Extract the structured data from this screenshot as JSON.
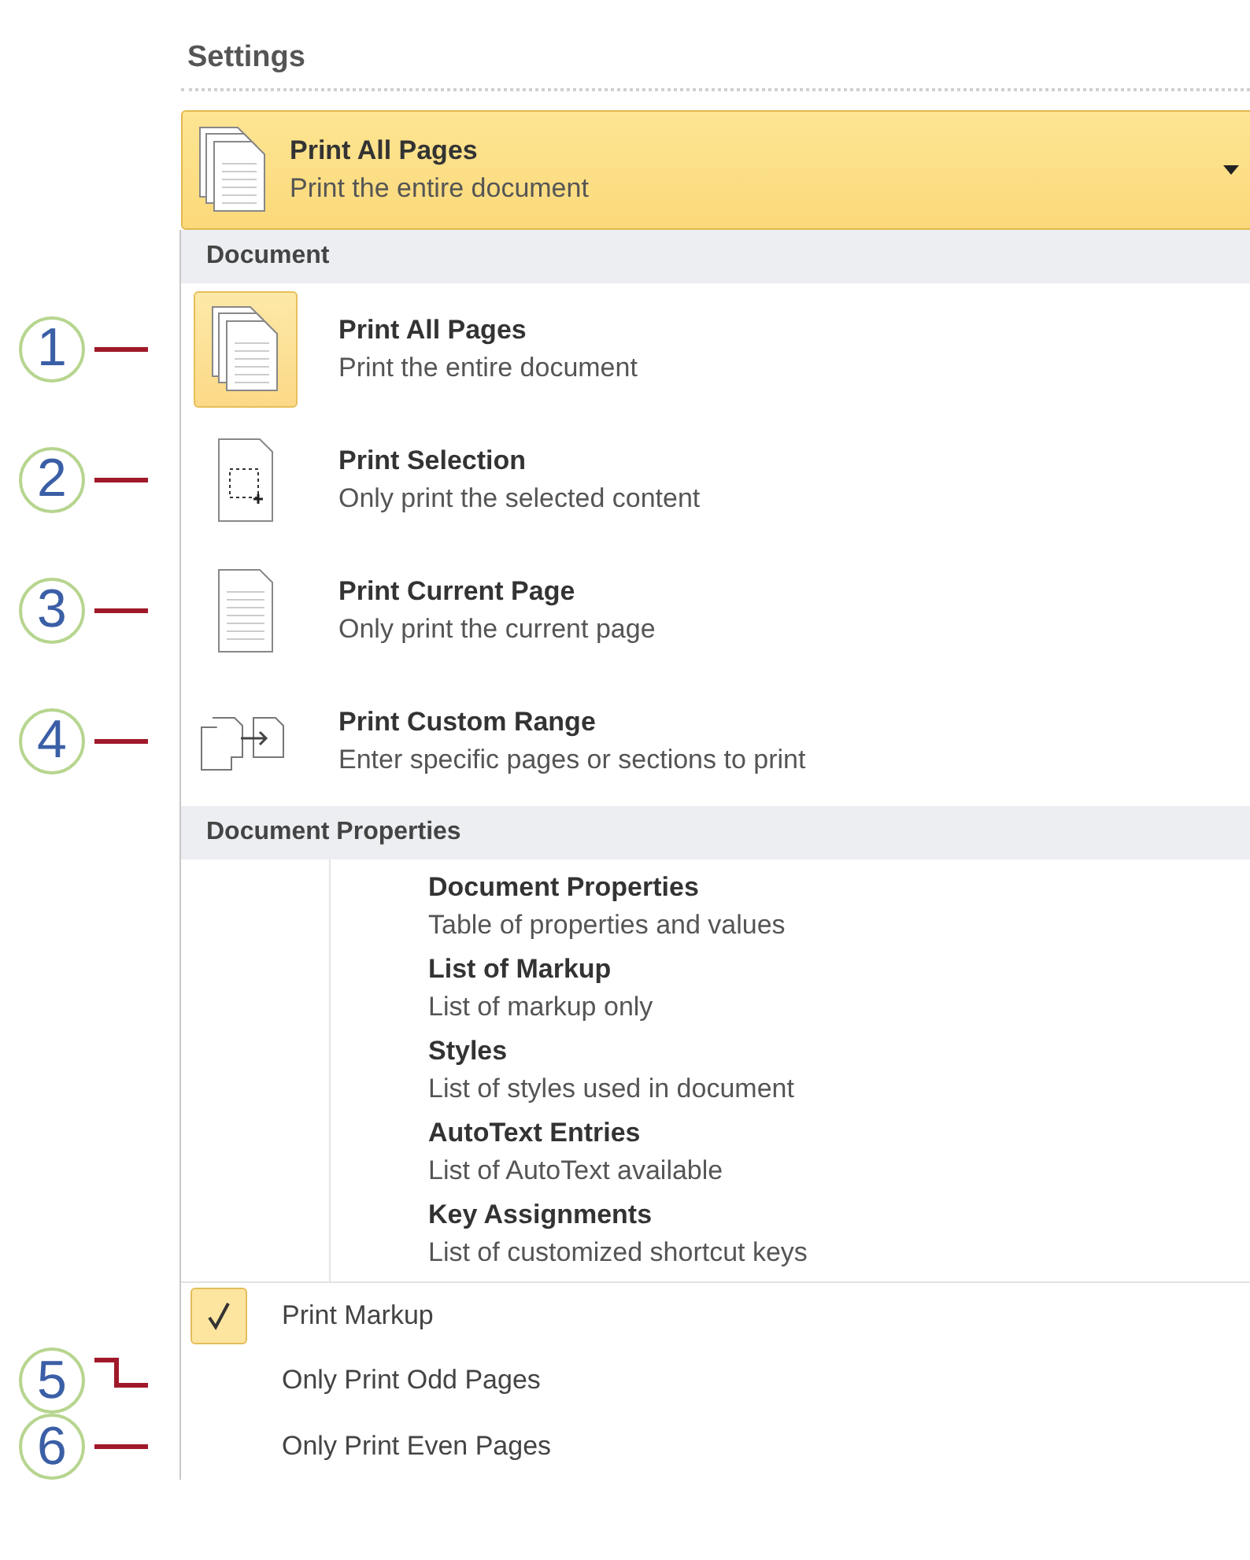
{
  "section_title": "Settings",
  "dropdown": {
    "kind": "pages",
    "title": "Print All Pages",
    "subtitle": "Print the entire document"
  },
  "groups": [
    {
      "header": "Document",
      "kind": "icon",
      "items": [
        {
          "kind": "pages",
          "title": "Print All Pages",
          "subtitle": "Print the entire document",
          "selected": true,
          "callout": {
            "number": "1",
            "kind": "straight"
          }
        },
        {
          "kind": "selection",
          "title": "Print Selection",
          "subtitle": "Only print the selected content",
          "selected": false,
          "callout": {
            "number": "2",
            "kind": "straight"
          }
        },
        {
          "kind": "page",
          "title": "Print Current Page",
          "subtitle": "Only print the current page",
          "selected": false,
          "callout": {
            "number": "3",
            "kind": "straight"
          }
        },
        {
          "kind": "range",
          "title": "Print Custom Range",
          "subtitle": "Enter specific pages or sections to print",
          "selected": false,
          "callout": {
            "number": "4",
            "kind": "straight"
          }
        }
      ]
    },
    {
      "header": "Document Properties",
      "kind": "text",
      "items": [
        {
          "title": "Document Properties",
          "subtitle": "Table of properties and values",
          "selected": false
        },
        {
          "title": "List of Markup",
          "subtitle": "List of markup only",
          "selected": false
        },
        {
          "title": "Styles",
          "subtitle": "List of styles used in document",
          "selected": false
        },
        {
          "title": "AutoText Entries",
          "subtitle": "List of AutoText available",
          "selected": false
        },
        {
          "title": "Key Assignments",
          "subtitle": "List of customized shortcut keys",
          "selected": false
        }
      ]
    }
  ],
  "options": [
    {
      "label": "Print Markup",
      "checked": true
    },
    {
      "label": "Only Print Odd Pages",
      "checked": false,
      "callout": {
        "number": "5",
        "kind": "step"
      }
    },
    {
      "label": "Only Print Even Pages",
      "checked": false,
      "callout": {
        "number": "6",
        "kind": "straight"
      }
    }
  ]
}
